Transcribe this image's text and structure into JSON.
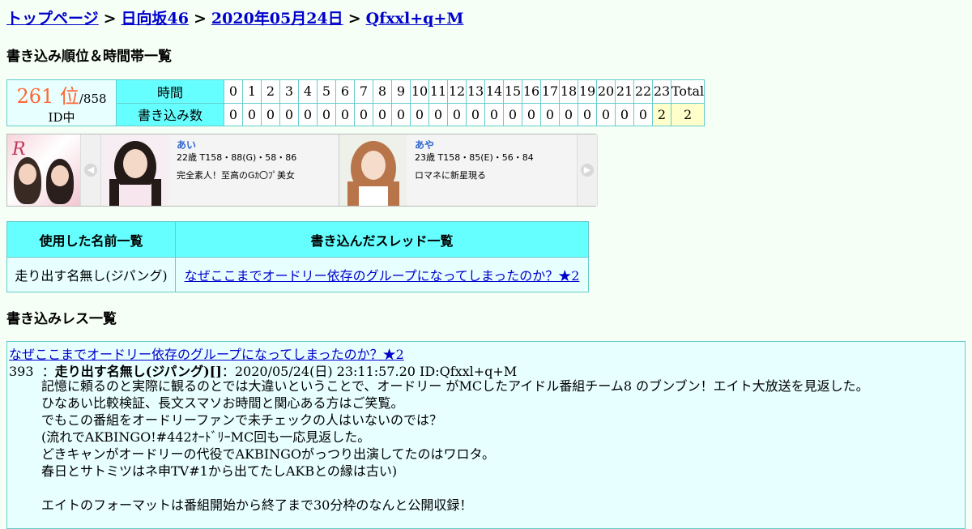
{
  "breadcrumb": {
    "items": [
      "トップページ",
      "日向坂46",
      "2020年05月24日",
      "Qfxxl+q+M"
    ],
    "separator": ">"
  },
  "ranking": {
    "title": "書き込み順位＆時間帯一覧",
    "rank": "261 位",
    "total": "/858 ID中",
    "time_label": "時間",
    "count_label": "書き込み数",
    "hours": [
      "0",
      "1",
      "2",
      "3",
      "4",
      "5",
      "6",
      "7",
      "8",
      "9",
      "10",
      "11",
      "12",
      "13",
      "14",
      "15",
      "16",
      "17",
      "18",
      "19",
      "20",
      "21",
      "22",
      "23",
      "Total"
    ],
    "counts": [
      "0",
      "0",
      "0",
      "0",
      "0",
      "0",
      "0",
      "0",
      "0",
      "0",
      "0",
      "0",
      "0",
      "0",
      "0",
      "0",
      "0",
      "0",
      "0",
      "0",
      "0",
      "0",
      "0",
      "2",
      "2"
    ]
  },
  "ad": {
    "prev_icon": "chevron-left-icon",
    "next_icon": "chevron-right-icon",
    "logo_tiny_lines": [
      "吉原中級ソープランド",
      "ロマネコンティ"
    ],
    "cards": [
      {
        "name": "あい",
        "spec": "22歳 T158・88(G)・58・86",
        "desc": "完全素人！至高のGｶ〇ﾌﾟ美女"
      },
      {
        "name": "あや",
        "spec": "23歳 T158・85(E)・56・84",
        "desc": "ロマネに新星現る"
      }
    ]
  },
  "names_table": {
    "col_names": "使用した名前一覧",
    "col_threads": "書き込んだスレッド一覧",
    "name": "走り出す名無し(ジパング)",
    "thread": "なぜここまでオードリー依存のグループになってしまったのか？★2"
  },
  "posts": {
    "title": "書き込みレス一覧",
    "thread_title": "なぜここまでオードリー依存のグループになってしまったのか？★2",
    "number": "393",
    "name": "走り出す名無し(ジパング)[]",
    "meta": "：2020/05/24(日) 23:11:57.20 ID:Qfxxl+q+M",
    "lines": [
      "記憶に頼るのと実際に観るのとでは大違いということで、オードリー がMCしたアイドル番組チーム8 のブンブン！エイト大放送を見返した。",
      "ひなあい比較検証、長文スマソお時間と関心ある方はご笑覧。",
      "でもこの番組をオードリーファンで未チェックの人はいないのでは？",
      "(流れでAKBINGO!#442ｵｰﾄﾞﾘｰMC回も一応見返した。",
      "どきキャンがオードリーの代役でAKBINGOがっつり出演してたのはワロタ。",
      "春日とサトミツはネ申TV#1から出てたしAKBとの縁は古い)",
      "",
      "エイトのフォーマットは番組開始から終了まで30分枠のなんと公開収録！"
    ]
  }
}
